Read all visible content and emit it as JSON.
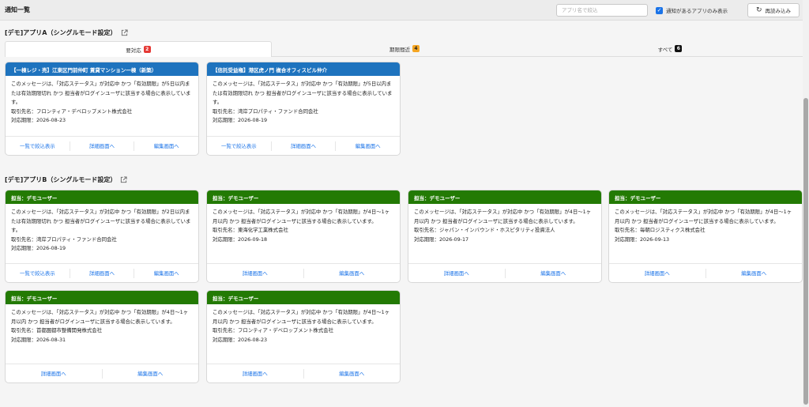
{
  "header": {
    "title": "通知一覧",
    "search_placeholder": "アプリ名で絞込",
    "filter_checkbox_label": "通知があるアプリのみ表示",
    "reload_label": "再読み込み",
    "accent_color": "#1a73e8"
  },
  "sections": [
    {
      "title": "[デモ]アプリA（シングルモード設定）",
      "tabs": [
        {
          "label": "要対応",
          "count": "2",
          "badge_color": "#e53935"
        },
        {
          "label": "期限間近",
          "count": "4",
          "badge_color": "#f5a623"
        },
        {
          "label": "すべて",
          "count": "6",
          "badge_color": "#111111"
        }
      ],
      "cards": [
        {
          "header": "【一棟レジ・売】江東区門前仲町 賃貸マンション一棟（新築）",
          "header_color": "#1e73be",
          "message": "このメッセージは、「対応ステータス」が対応中 かつ「有効期限」が5日以内または有効期限切れ かつ 担当者がログインユーザに該当する場合に表示しています。",
          "client": "取引先名：フロンティア・デベロップメント株式会社",
          "deadline": "対応期限：2026-08-23",
          "actions": [
            "一覧で絞込表示",
            "詳細画面へ",
            "編集画面へ"
          ]
        },
        {
          "header": "【信託受益権】港区虎ノ門 複合オフィスビル仲介",
          "header_color": "#1e73be",
          "message": "このメッセージは、「対応ステータス」が対応中 かつ「有効期限」が5日以内または有効期限切れ かつ 担当者がログインユーザに該当する場合に表示しています。",
          "client": "取引先名：湾岸プロパティ・ファンド合同会社",
          "deadline": "対応期限：2026-08-19",
          "actions": [
            "一覧で絞込表示",
            "詳細画面へ",
            "編集画面へ"
          ]
        }
      ]
    },
    {
      "title": "[デモ]アプリB（シングルモード設定）",
      "cards": [
        {
          "header": "担当：デモユーザー",
          "header_color": "#237a04",
          "message": "このメッセージは、「対応ステータス」が対応中 かつ「有効期限」が2日以内または有効期限切れ かつ 担当者がログインユーザに該当する場合に表示しています。",
          "client": "取引先名：湾岸プロパティ・ファンド合同会社",
          "deadline": "対応期限：2026-08-19",
          "actions": [
            "一覧で絞込表示",
            "詳細画面へ",
            "編集画面へ"
          ]
        },
        {
          "header": "担当：デモユーザー",
          "header_color": "#237a04",
          "message": "このメッセージは、「対応ステータス」が対応中 かつ「有効期限」が4日〜1ヶ月以内 かつ 担当者がログインユーザに該当する場合に表示しています。",
          "client": "取引先名：東海化学工業株式会社",
          "deadline": "対応期限：2026-09-18",
          "actions": [
            "詳細画面へ",
            "編集画面へ"
          ]
        },
        {
          "header": "担当：デモユーザー",
          "header_color": "#237a04",
          "message": "このメッセージは、「対応ステータス」が対応中 かつ「有効期限」が4日〜1ヶ月以内 かつ 担当者がログインユーザに該当する場合に表示しています。",
          "client": "取引先名：ジャパン・インバウンド・ホスピタリティ投資法人",
          "deadline": "対応期限：2026-09-17",
          "actions": [
            "詳細画面へ",
            "編集画面へ"
          ]
        },
        {
          "header": "担当：デモユーザー",
          "header_color": "#237a04",
          "message": "このメッセージは、「対応ステータス」が対応中 かつ「有効期限」が4日〜1ヶ月以内 かつ 担当者がログインユーザに該当する場合に表示しています。",
          "client": "取引先名：毎朝ロジスティクス株式会社",
          "deadline": "対応期限：2026-09-13",
          "actions": [
            "詳細画面へ",
            "編集画面へ"
          ]
        },
        {
          "header": "担当：デモユーザー",
          "header_color": "#237a04",
          "message": "このメッセージは、「対応ステータス」が対応中 かつ「有効期限」が4日〜1ヶ月以内 かつ 担当者がログインユーザに該当する場合に表示しています。",
          "client": "取引先名：首都圏都市整備開発株式会社",
          "deadline": "対応期限：2026-08-31",
          "actions": [
            "詳細画面へ",
            "編集画面へ"
          ]
        },
        {
          "header": "担当：デモユーザー",
          "header_color": "#237a04",
          "message": "このメッセージは、「対応ステータス」が対応中 かつ「有効期限」が4日〜1ヶ月以内 かつ 担当者がログインユーザに該当する場合に表示しています。",
          "client": "取引先名：フロンティア・デベロップメント株式会社",
          "deadline": "対応期限：2026-08-23",
          "actions": [
            "詳細画面へ",
            "編集画面へ"
          ]
        }
      ]
    }
  ]
}
